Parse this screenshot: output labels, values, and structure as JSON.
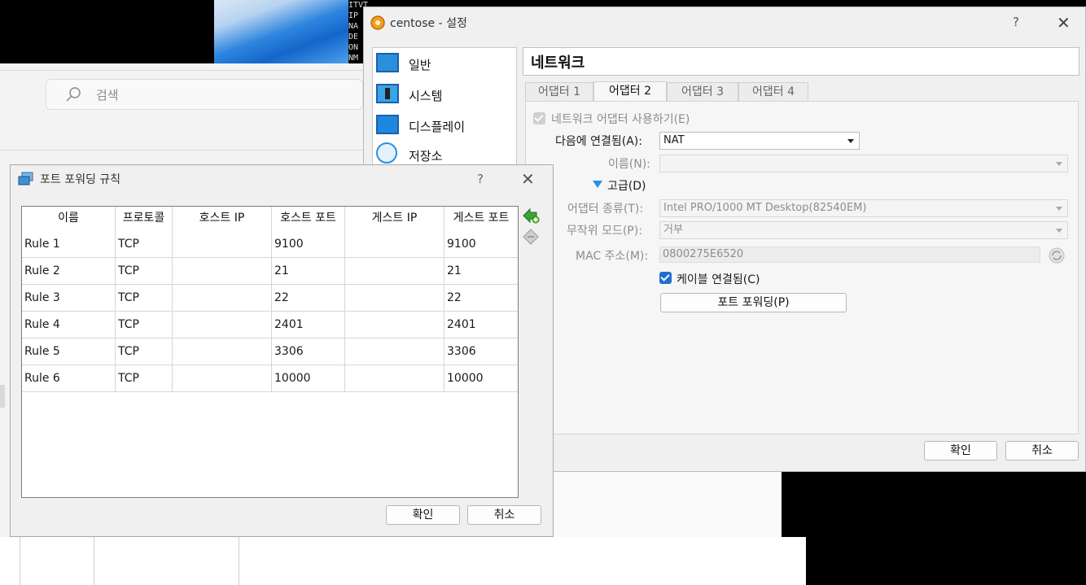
{
  "background": {
    "terminal_lines": [
      "ITVT_TAILSHO_TIIIE HO",
      "IP",
      "NA",
      "DE",
      "ON",
      "NM"
    ],
    "search": {
      "placeholder": "검색"
    }
  },
  "settings": {
    "window_title": "centose - 설정",
    "help": "?",
    "close": "✕",
    "categories": [
      {
        "label": "일반",
        "icon": "general-monitor-icon"
      },
      {
        "label": "시스템",
        "icon": "system-chip-icon"
      },
      {
        "label": "디스플레이",
        "icon": "display-monitor-icon"
      },
      {
        "label": "저장소",
        "icon": "storage-disk-icon"
      }
    ],
    "page_title": "네트워크",
    "tabs": [
      "어댑터 1",
      "어댑터 2",
      "어댑터 3",
      "어댑터 4"
    ],
    "active_tab": 1,
    "enable_adapter": "네트워크 어댑터 사용하기(E)",
    "attached_to_label": "다음에 연결됨(A):",
    "attached_to_value": "NAT",
    "name_label": "이름(N):",
    "name_value": "",
    "advanced_label": "고급(D)",
    "adapter_type_label": "어댑터 종류(T):",
    "adapter_type_value": "Intel PRO/1000 MT Desktop(82540EM)",
    "promiscuous_label": "무작위 모드(P):",
    "promiscuous_value": "거부",
    "mac_label": "MAC 주소(M):",
    "mac_value": "0800275E6520",
    "cable_connected": "케이블 연결됨(C)",
    "port_forwarding_button": "포트 포워딩(P)",
    "ok": "확인",
    "cancel": "취소"
  },
  "port_forwarding": {
    "title": "포트 포워딩 규칙",
    "help": "?",
    "close": "✕",
    "columns": [
      "이름",
      "프로토콜",
      "호스트 IP",
      "호스트 포트",
      "게스트 IP",
      "게스트 포트"
    ],
    "rows": [
      {
        "name": "Rule 1",
        "protocol": "TCP",
        "host_ip": "",
        "host_port": "9100",
        "guest_ip": "",
        "guest_port": "9100"
      },
      {
        "name": "Rule 2",
        "protocol": "TCP",
        "host_ip": "",
        "host_port": "21",
        "guest_ip": "",
        "guest_port": "21"
      },
      {
        "name": "Rule 3",
        "protocol": "TCP",
        "host_ip": "",
        "host_port": "22",
        "guest_ip": "",
        "guest_port": "22"
      },
      {
        "name": "Rule 4",
        "protocol": "TCP",
        "host_ip": "",
        "host_port": "2401",
        "guest_ip": "",
        "guest_port": "2401"
      },
      {
        "name": "Rule 5",
        "protocol": "TCP",
        "host_ip": "",
        "host_port": "3306",
        "guest_ip": "",
        "guest_port": "3306"
      },
      {
        "name": "Rule 6",
        "protocol": "TCP",
        "host_ip": "",
        "host_port": "10000",
        "guest_ip": "",
        "guest_port": "10000"
      }
    ],
    "ok": "확인",
    "cancel": "취소"
  }
}
